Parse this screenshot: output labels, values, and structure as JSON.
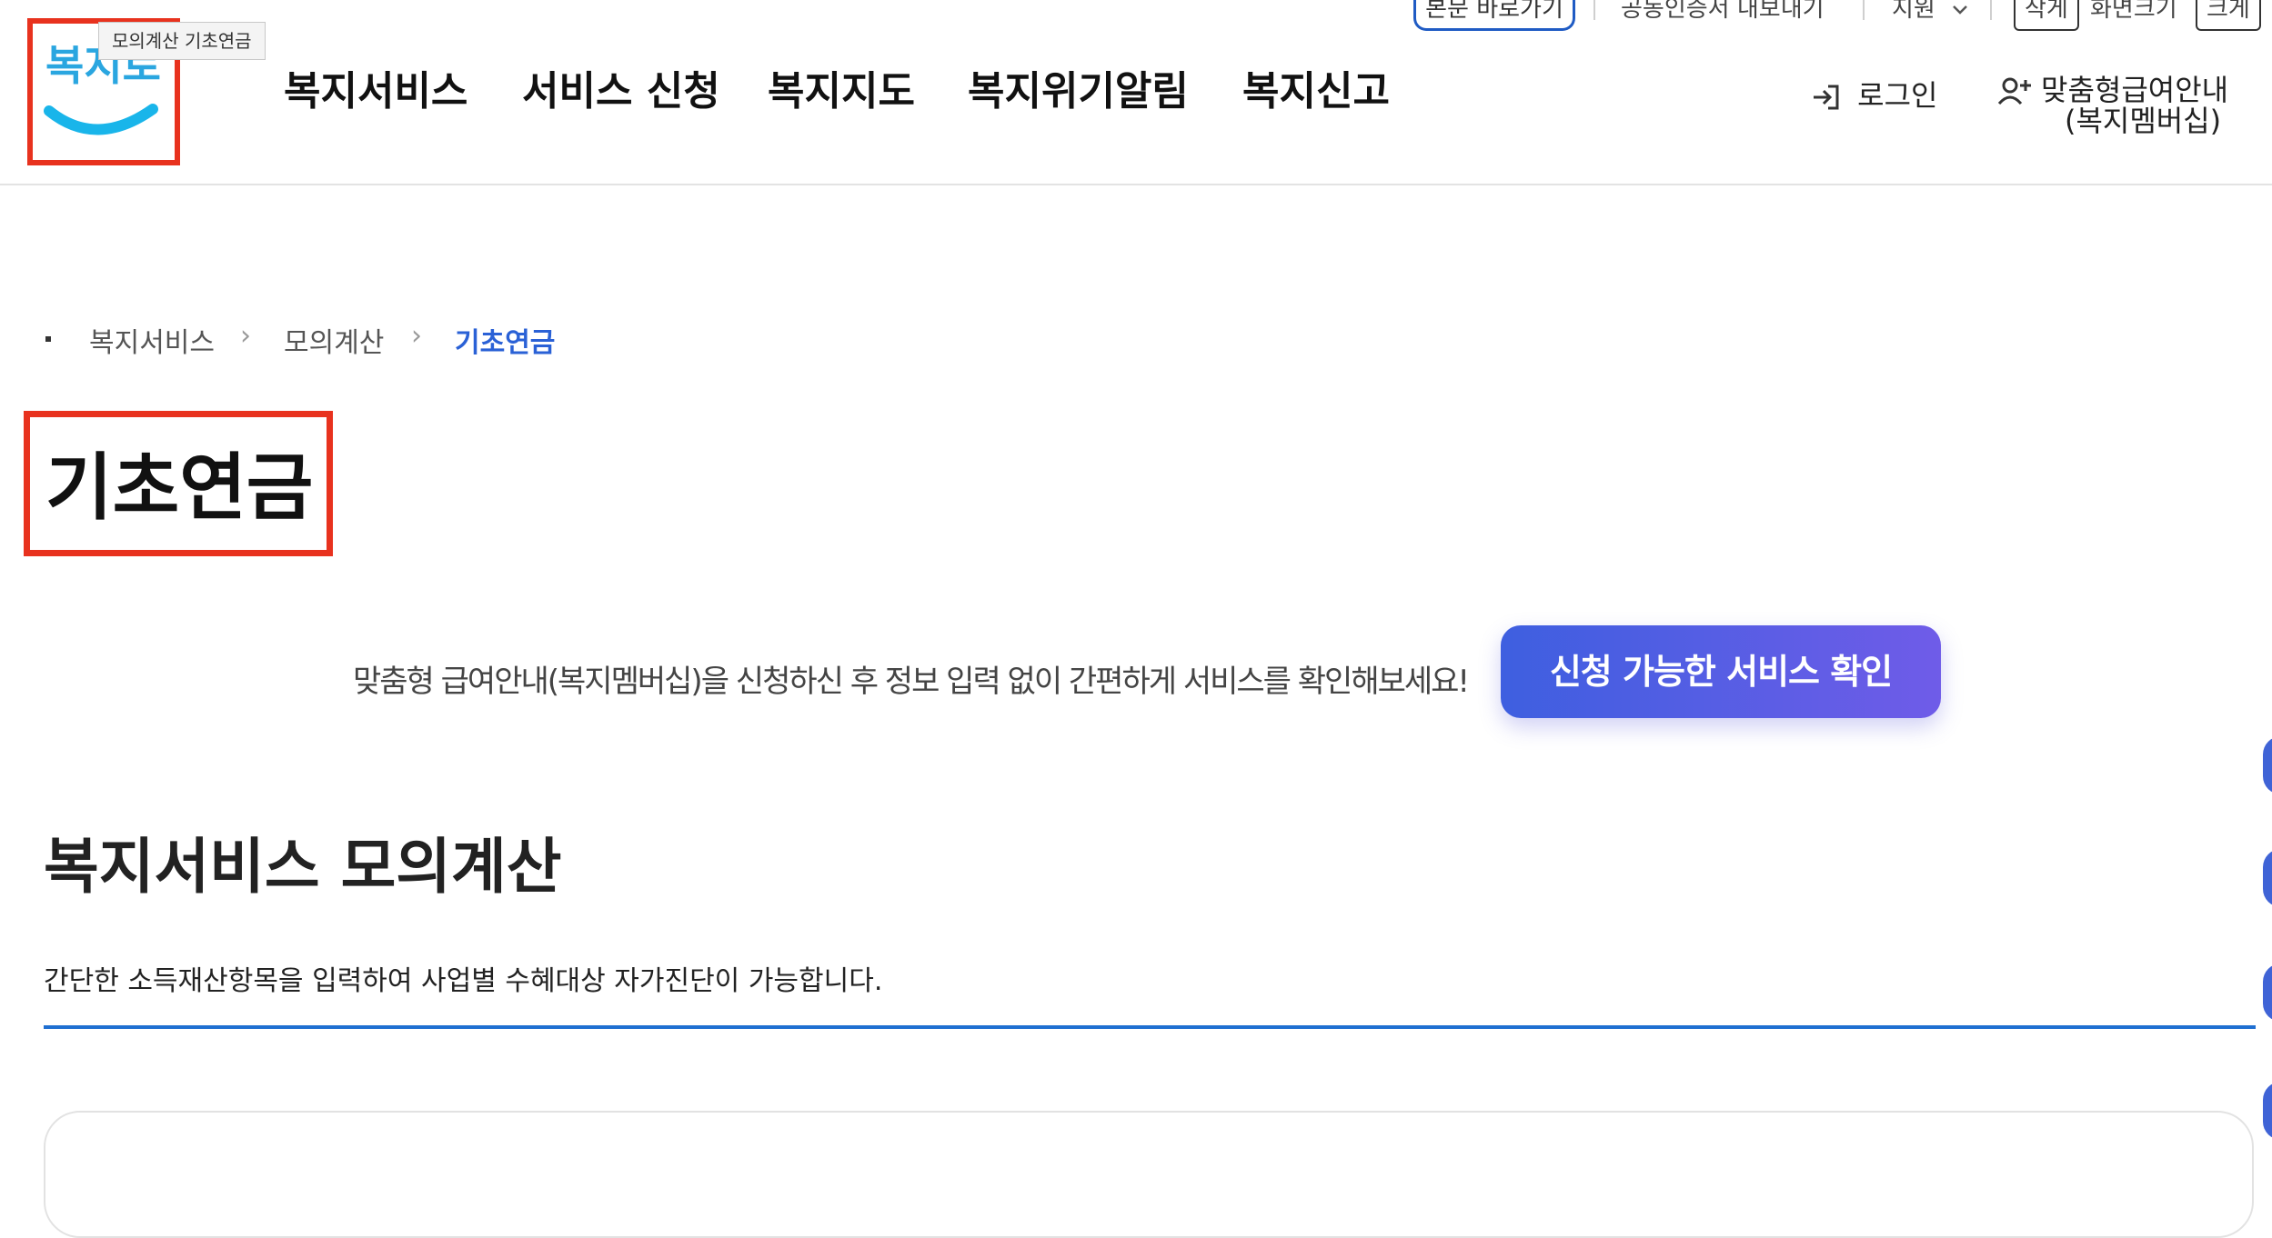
{
  "utility_bar": {
    "skip_to_content": "본문 바로가기",
    "certificate_export": "공동인증서 내보내기",
    "language": "지원",
    "font_small": "작게",
    "screen_size": "화면크기",
    "font_large": "크게"
  },
  "header": {
    "logo_text": "복지로",
    "tooltip": "모의계산 기초연금",
    "nav": [
      "복지서비스",
      "서비스 신청",
      "복지지도",
      "복지위기알림",
      "복지신고"
    ],
    "login": "로그인",
    "membership_line1": "맞춤형급여안내",
    "membership_line2": "(복지멤버십)"
  },
  "breadcrumb": {
    "items": [
      "복지서비스",
      "모의계산",
      "기초연금"
    ]
  },
  "page_title": "기초연금",
  "banner": {
    "text": "맞춤형 급여안내(복지멤버십)을 신청하신 후 정보 입력 없이 간편하게 서비스를 확인해보세요!",
    "button": "신청 가능한 서비스 확인"
  },
  "section": {
    "title": "복지서비스 모의계산",
    "description": "간단한 소득재산항목을 입력하여 사업별 수혜대상 자가진단이 가능합니다."
  },
  "colors": {
    "accent_blue": "#1f6fd1",
    "highlight_red": "#e8321e",
    "button_gradient_start": "#3e5fe0",
    "button_gradient_end": "#6f5ce8"
  }
}
